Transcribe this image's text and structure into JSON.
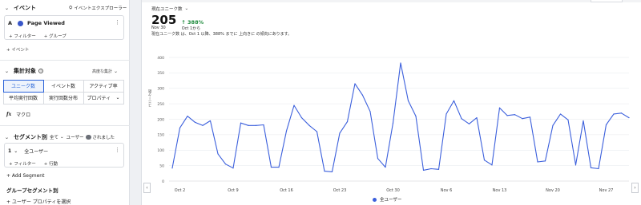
{
  "left_panel": {
    "events": {
      "title": "イベント",
      "explorer_label": "イベントエクスプローラー",
      "item": {
        "letter": "A",
        "name": "Page Viewed"
      },
      "filter_link": "+ フィルター",
      "group_link": "+ グループ",
      "add_event": "+ イベント"
    },
    "measure": {
      "title": "集計対象",
      "advanced": "高度な集計",
      "options": [
        [
          "ユニーク数",
          "イベント数",
          "アクティブ率"
        ],
        [
          "平均実行回数",
          "実行回数分布",
          "プロパティ"
        ]
      ],
      "selected": "ユニーク数",
      "macro": "マクロ"
    },
    "segments": {
      "title": "セグメント別",
      "all_label": "全て",
      "info": "ユーザー",
      "info2": "されました",
      "item": {
        "index": "1",
        "name": "全ユーザー"
      },
      "filter_link": "+ フィルター",
      "action_link": "+ 行動",
      "add_segment": "+ Add Segment",
      "group_title": "グループセグメント別",
      "select_property": "+ ユーザー プロパティを選択"
    }
  },
  "chart_header": {
    "metric_label": "現在ユニーク数",
    "value": "205",
    "change": "↑ 388%",
    "date": "Nov 30",
    "since": "Oct 1から",
    "description": "現在ユニーク数 は、Oct 1 以降、388% までに 上向きに の傾向にあります。"
  },
  "chart_data": {
    "type": "line",
    "ylabel": "ユニーク数",
    "ylim": [
      0,
      400
    ],
    "yticks": [
      0,
      50,
      100,
      150,
      200,
      250,
      300,
      350,
      400
    ],
    "xtick_labels": [
      "Oct 2",
      "Oct 9",
      "Oct 16",
      "Oct 23",
      "Oct 30",
      "Nov 6",
      "Nov 13",
      "Nov 20",
      "Nov 27"
    ],
    "xtick_index": [
      1,
      8,
      15,
      22,
      29,
      36,
      43,
      50,
      57
    ],
    "series": [
      {
        "name": "全ユーザー",
        "color": "#3b5fdc",
        "values": [
          42,
          172,
          210,
          190,
          180,
          195,
          88,
          55,
          42,
          188,
          180,
          180,
          182,
          45,
          45,
          162,
          245,
          205,
          180,
          160,
          32,
          30,
          155,
          192,
          315,
          278,
          225,
          73,
          45,
          188,
          382,
          260,
          210,
          35,
          40,
          38,
          217,
          260,
          202,
          185,
          205,
          68,
          52,
          237,
          212,
          215,
          202,
          207,
          62,
          65,
          180,
          217,
          198,
          52,
          195,
          43,
          40,
          182,
          217,
          220,
          205
        ]
      }
    ]
  },
  "colors": {
    "accent": "#1f5fd6",
    "line": "#3b5fdc",
    "positive": "#1e8a3c"
  }
}
